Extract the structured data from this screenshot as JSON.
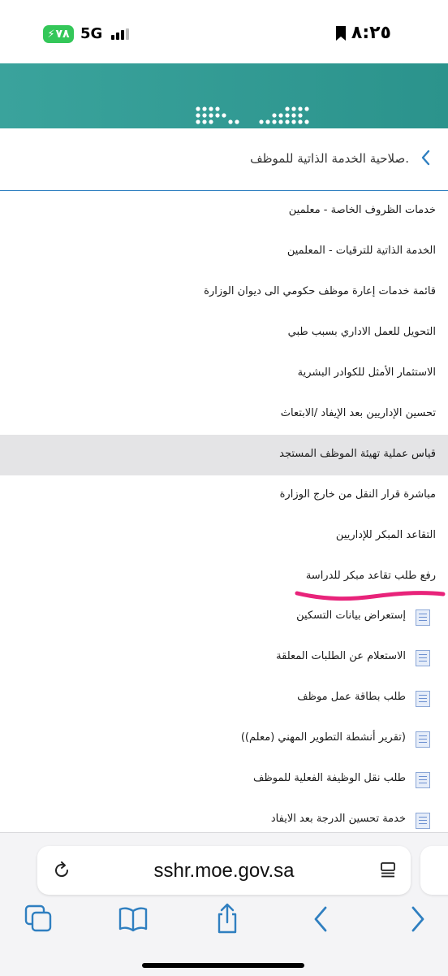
{
  "status_bar": {
    "time": "٨:٢٥",
    "network": "5G",
    "battery": "٧٨"
  },
  "header": {
    "title": ".صلاحية الخدمة الذاتية للموظف"
  },
  "menu": {
    "items": [
      {
        "label": "خدمات الظروف الخاصة - معلمين",
        "active": false
      },
      {
        "label": "الخدمة الذاتية للترقيات - المعلمين",
        "active": false
      },
      {
        "label": "قائمة خدمات إعارة موظف حكومي الى ديوان الوزارة",
        "active": false
      },
      {
        "label": "التحويل للعمل الاداري بسبب طبي",
        "active": false
      },
      {
        "label": "الاستثمار الأمثل للكوادر البشرية",
        "active": false
      },
      {
        "label": "تحسين الإداريين بعد الإيفاد /الابتعاث",
        "active": false
      },
      {
        "label": "قياس عملية تهيئة الموظف المستجد",
        "active": true
      },
      {
        "label": "مباشرة قرار النقل من خارج الوزارة",
        "active": false
      },
      {
        "label": "التقاعد المبكر للإداريين",
        "active": false
      },
      {
        "label": "رفع طلب تقاعد مبكر للدراسة",
        "active": false
      }
    ]
  },
  "documents": {
    "items": [
      {
        "label": "إستعراض بيانات التسكين",
        "icon": "document-icon"
      },
      {
        "label": "الاستعلام عن الطلبات المعلقة",
        "icon": "document-icon"
      },
      {
        "label": "طلب بطاقة عمل موظف",
        "icon": "document-icon"
      },
      {
        "label": "(تقرير أنشطة التطوير المهني (معلم))",
        "icon": "document-icon"
      },
      {
        "label": "طلب نقل الوظيفة الفعلية للموظف",
        "icon": "document-icon"
      },
      {
        "label": "خدمة تحسين الدرجة بعد الايفاد",
        "icon": "document-icon"
      }
    ]
  },
  "browser": {
    "url": "sshr.moe.gov.sa"
  },
  "colors": {
    "banner": "#2b938c",
    "accent": "#2f7fc0",
    "highlight": "#e8237a",
    "battery": "#34c759"
  }
}
